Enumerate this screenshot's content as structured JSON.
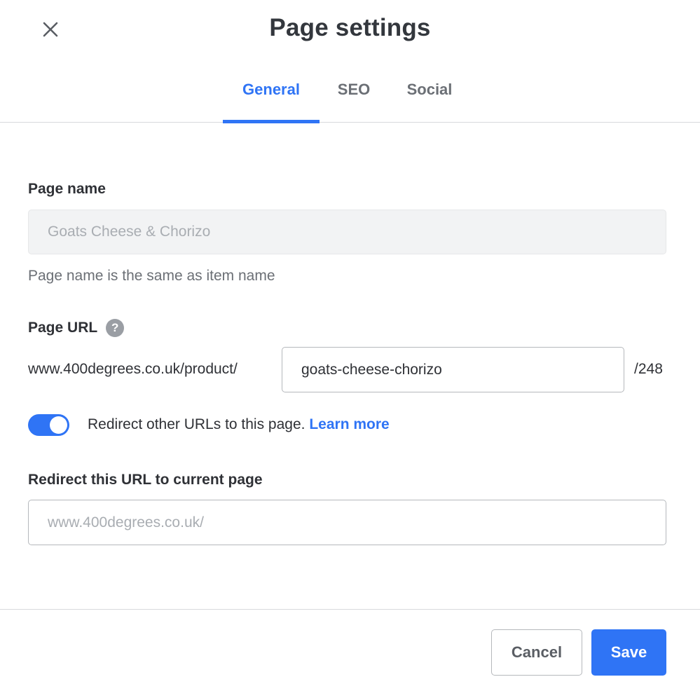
{
  "header": {
    "title": "Page settings",
    "close_icon": "close-icon"
  },
  "tabs": [
    {
      "label": "General",
      "active": true
    },
    {
      "label": "SEO",
      "active": false
    },
    {
      "label": "Social",
      "active": false
    }
  ],
  "page_name": {
    "label": "Page name",
    "value": "Goats Cheese & Chorizo",
    "hint": "Page name is the same as item name"
  },
  "page_url": {
    "label": "Page URL",
    "help_icon": "help-icon",
    "help_glyph": "?",
    "prefix": "www.400degrees.co.uk/product/",
    "slug": "goats-cheese-chorizo",
    "suffix": "/248"
  },
  "redirect_toggle": {
    "enabled": true,
    "text": "Redirect other URLs to this page.",
    "link": "Learn more"
  },
  "redirect_url": {
    "label": "Redirect this URL to current page",
    "placeholder": "www.400degrees.co.uk/"
  },
  "footer": {
    "cancel_label": "Cancel",
    "save_label": "Save"
  },
  "colors": {
    "accent": "#2f74f5",
    "text": "#2f3136",
    "muted": "#6b6f75"
  }
}
